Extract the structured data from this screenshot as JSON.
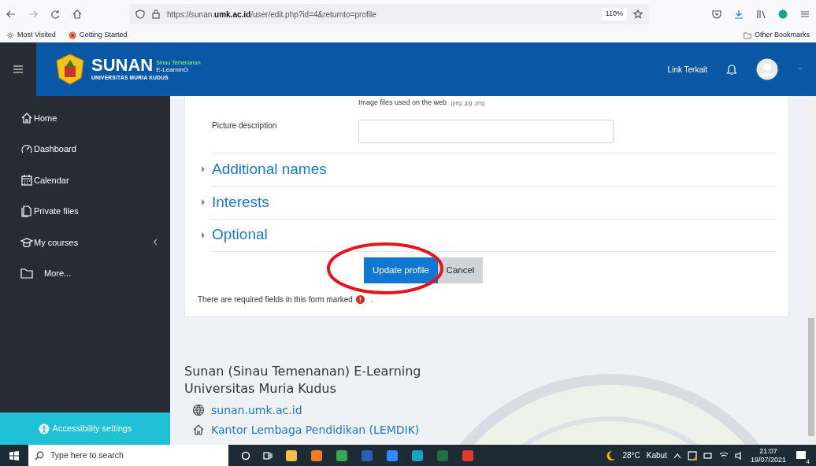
{
  "browser": {
    "url_host": "https://sunan.",
    "url_domain": "umk.ac.id",
    "url_path": "/user/edit.php?id=4&returnto=profile",
    "zoom": "110%"
  },
  "bookmarks": [
    {
      "label": "Most Visited"
    },
    {
      "label": "Getting Started"
    }
  ],
  "other_bookmarks": "Other Bookmarks",
  "navbar": {
    "logo_title": "SUNAN",
    "logo_tag": "Sinau Temenanan",
    "logo_sub": "E-LearninG",
    "logo_org": "UNIVERSITAS MURIA KUDUS",
    "link": "Link Terkait"
  },
  "sidebar": {
    "items": [
      {
        "label": "Home"
      },
      {
        "label": "Dashboard"
      },
      {
        "label": "Calendar"
      },
      {
        "label": "Private files"
      },
      {
        "label": "My courses",
        "expanded": false
      },
      {
        "label": "More..."
      }
    ],
    "accessibility": "Accessibility settings"
  },
  "form": {
    "hint": "Image files used on the web",
    "hint_types": ".jpeg .jpg .png",
    "description_label": "Picture description",
    "sections": [
      {
        "label": "Additional names",
        "expanded": false
      },
      {
        "label": "Interests",
        "expanded": false
      },
      {
        "label": "Optional",
        "expanded": false
      }
    ],
    "buttons": [
      {
        "label": "Update profile",
        "kind": "primary"
      },
      {
        "label": "Cancel",
        "kind": "secondary"
      }
    ],
    "required_note": "There are required fields in this form marked",
    "required_note_end": "."
  },
  "footer": {
    "title_lines": [
      "Sunan (Sinau Temenanan) E-Learning",
      "Universitas Muria Kudus"
    ],
    "links": [
      {
        "label": "sunan.umk.ac.id"
      },
      {
        "label": "Kantor Lembaga Pendidikan (LEMDIK)"
      }
    ]
  },
  "taskbar": {
    "search_placeholder": "Type here to search",
    "temperature": "28°C",
    "weather": "Kabut",
    "time": "21:07",
    "date": "19/07/2021",
    "notifications": "4"
  }
}
